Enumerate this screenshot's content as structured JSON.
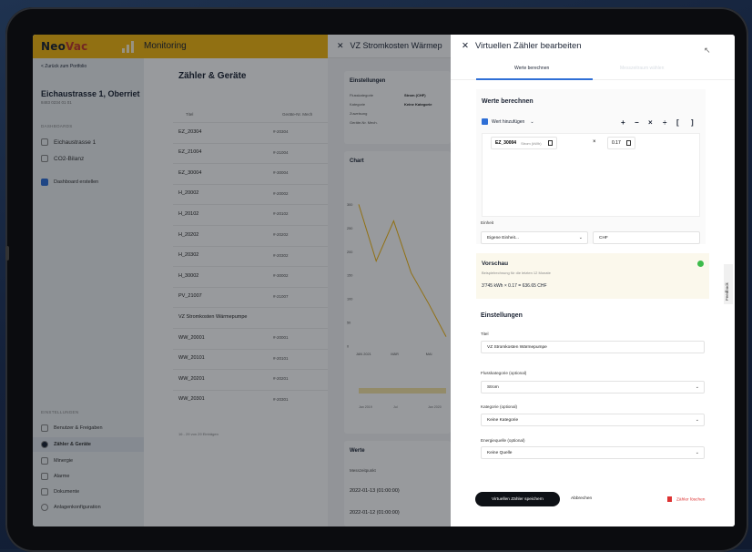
{
  "app": {
    "logo_part1": "Neo",
    "logo_part2": "Vac",
    "title": "Monitoring"
  },
  "sidebar": {
    "back": "< Zurück zum Portfolio",
    "property": "Eichaustrasse 1, Oberriet",
    "property_id": "8483 0234 01 01",
    "dashboards_label": "DASHBOARDS",
    "dashboards": [
      "Eichaustrasse 1",
      "CO2-Bilanz"
    ],
    "create_dashboard": "Dashboard erstellen",
    "settings_label": "EINSTELLUNGEN",
    "settings": [
      "Benutzer & Freigaben",
      "Zähler & Geräte",
      "Minergie",
      "Alarme",
      "Dokumente",
      "Anlagenkonfiguration"
    ]
  },
  "main": {
    "title": "Zähler & Geräte",
    "columns": [
      "Titel",
      "Geräte-Nr. Mech"
    ],
    "rows": [
      [
        "EZ_20304",
        "#-20304"
      ],
      [
        "EZ_21004",
        "#-21004"
      ],
      [
        "EZ_30004",
        "#-30004"
      ],
      [
        "H_20002",
        "#-20002"
      ],
      [
        "H_20102",
        "#-20102"
      ],
      [
        "H_20202",
        "#-20202"
      ],
      [
        "H_20302",
        "#-20302"
      ],
      [
        "H_30002",
        "#-30002"
      ],
      [
        "PV_21007",
        "#-21007"
      ],
      [
        "VZ Stromkosten Wärmepumpe",
        ""
      ],
      [
        "WW_20001",
        "#-20001"
      ],
      [
        "WW_20101",
        "#-20101"
      ],
      [
        "WW_20201",
        "#-20201"
      ],
      [
        "WW_20301",
        "#-20301"
      ]
    ],
    "paging": "16 - 29 von 29 Einträgen"
  },
  "panel2": {
    "title": "VZ Stromkosten Wärmep",
    "settings_title": "Einstellungen",
    "settings": [
      [
        "Flusskategorie",
        "Strom (CHF)"
      ],
      [
        "Kategorie",
        "Keine Kategorie"
      ],
      [
        "Zuweisung",
        ""
      ],
      [
        "Geräte-Nr. Mech.",
        ""
      ]
    ],
    "chart_title": "Chart",
    "werte_title": "Werte",
    "werte_col": "Messzeitpunkt",
    "werte_rows": [
      "2022-01-13 (01:00:00)",
      "2022-01-12 (01:00:00)"
    ]
  },
  "chart_data": {
    "type": "line",
    "title": "Chart",
    "x": [
      "JAN 2021",
      "",
      "MÄR",
      "",
      "MAI",
      ""
    ],
    "values": [
      300,
      180,
      265,
      155,
      90,
      20
    ],
    "yticks": [
      0,
      50,
      100,
      150,
      200,
      250,
      300
    ],
    "ylim": [
      0,
      320
    ],
    "range_ticks": [
      "Jan 2019",
      "Jul",
      "Jan 2020"
    ],
    "color": "#f3b711"
  },
  "editor": {
    "title": "Virtuellen Zähler bearbeiten",
    "tab_active": "Werte berechnen",
    "tab_inactive": "Messzeitraum wählen",
    "section_calc": "Werte berechnen",
    "add_value": "Wert hinzufügen",
    "operators": [
      "+",
      "−",
      "×",
      "÷",
      "[",
      "]"
    ],
    "chip1_name": "EZ_30004",
    "chip1_unit": "Strom (kWh)",
    "multiply": "×",
    "chip2_value": "0.17",
    "unit_label": "Einheit",
    "unit_select": "Eigene Einheit...",
    "unit_value": "CHF",
    "preview_title": "Vorschau",
    "preview_sub": "Beispielrechnung für die letzten 12 Monate",
    "preview_formula": "3'745 kWh × 0.17 = 636.65 CHF",
    "settings_title": "Einstellungen",
    "title_label": "Titel",
    "title_value": "VZ Stromkosten Wärmepumpe",
    "flow_label": "Flusskategorie (optional)",
    "flow_value": "Strom",
    "cat_label": "Kategorie (optional)",
    "cat_value": "Keine Kategorie",
    "source_label": "Energiequelle (optional)",
    "source_value": "Keine Quelle",
    "save_button": "Virtuellen Zähler speichern",
    "cancel_button": "Abbrechen",
    "delete_button": "Zähler löschen",
    "feedback": "Feedback"
  },
  "colors": {
    "brand": "#f3b711",
    "accent": "#2f6fd6",
    "ok": "#3dbb4b",
    "danger": "#d33"
  }
}
